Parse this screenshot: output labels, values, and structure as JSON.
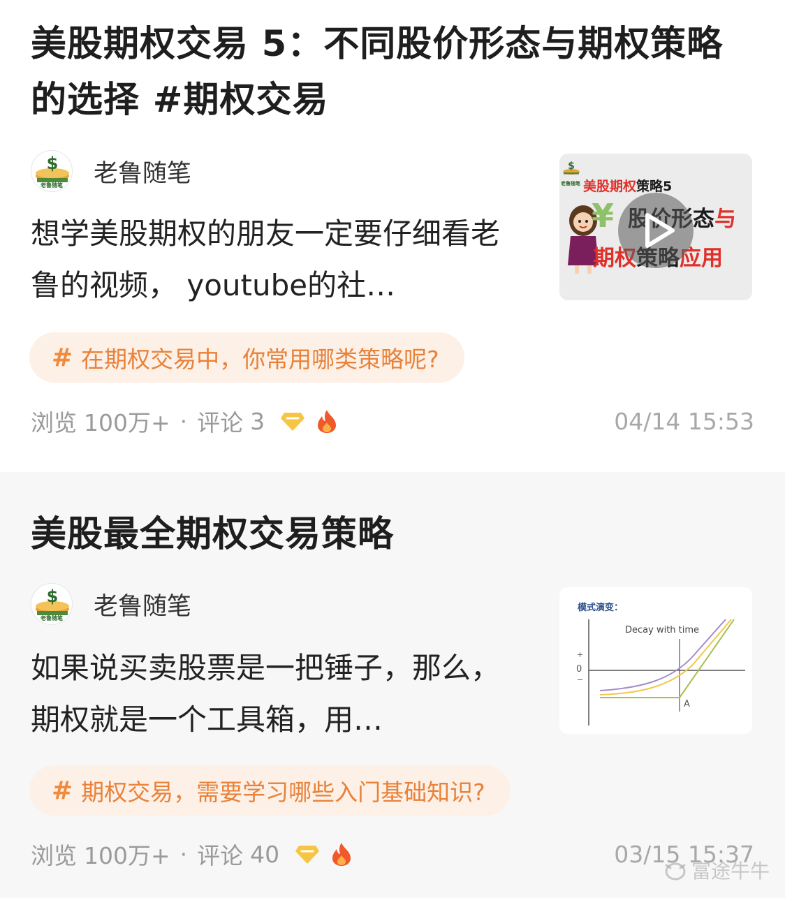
{
  "posts": [
    {
      "title": "美股期权交易 5：不同股价形态与期权策略的选择 #期权交易",
      "author": "老鲁随笔",
      "avatar_text": "老鲁随笔",
      "excerpt": "想学美股期权的朋友一定要仔细看老鲁的视频， youtube的社…",
      "thumb": {
        "avatar_text": "老鲁随笔",
        "line1_red": "美股期权",
        "line1_black": "策略5",
        "line2_black": "股价形态",
        "line2_red": "与",
        "line3_red": "期权",
        "line3_black": "策略",
        "line3_red2": "应用",
        "yen": "¥"
      },
      "topic": "在期权交易中，你常用哪类策略呢?",
      "views_label": "浏览",
      "views": "100万+",
      "comments_label": "评论",
      "comments": "3",
      "date": "04/14 15:53"
    },
    {
      "title": "美股最全期权交易策略",
      "author": "老鲁随笔",
      "avatar_text": "老鲁随笔",
      "excerpt": "如果说买卖股票是一把锤子，那么，期权就是一个工具箱，用…",
      "thumb": {
        "heading": "模式演变：",
        "caption": "Decay with time",
        "plus": "+",
        "zero": "0",
        "minus": "−",
        "point": "A"
      },
      "topic": "期权交易，需要学习哪些入门基础知识?",
      "views_label": "浏览",
      "views": "100万+",
      "comments_label": "评论",
      "comments": "40",
      "date": "03/15 15:37"
    }
  ],
  "watermark": "富途牛牛",
  "colors": {
    "topic_bg": "#fdf0e6",
    "topic_text": "#e8823a",
    "meta_text": "#9a9a9a",
    "gem": "#f6c543",
    "fire": "#f05a2a"
  },
  "icons": {
    "play": "play-icon",
    "gem": "gem-icon",
    "fire": "fire-icon",
    "dollar": "dollar-icon"
  }
}
